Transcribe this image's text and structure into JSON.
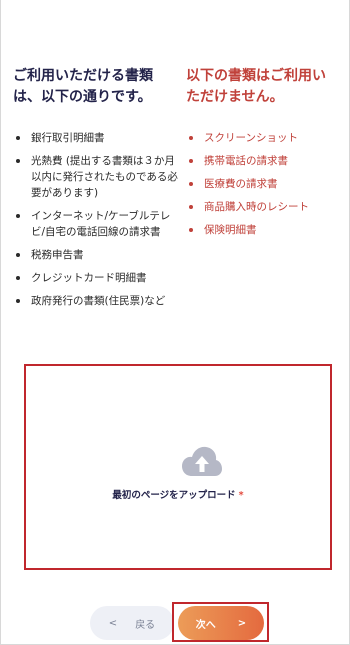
{
  "accepted": {
    "heading_line1": "ご利用いただける書類",
    "heading_line2": "は、以下の通りです。",
    "items": [
      "銀行取引明細書",
      "光熱費 (提出する書類は３か月以内に発行されたものである必要があります)",
      "インターネット/ケーブルテレビ/自宅の電話回線の請求書",
      "税務申告書",
      "クレジットカード明細書",
      "政府発行の書類(住民票)など"
    ]
  },
  "rejected": {
    "heading_line1": "以下の書類はご利用い",
    "heading_line2": "ただけません。",
    "items": [
      "スクリーンショット",
      "携帯電話の請求書",
      "医療費の請求書",
      "商品購入時のレシート",
      "保険明細書"
    ]
  },
  "upload": {
    "label": "最初のページをアップロード",
    "required_mark": "*",
    "icon": "cloud-upload-icon"
  },
  "nav": {
    "back_arrow": "<",
    "back_label": "戻る",
    "next_label": "次へ",
    "next_arrow": ">"
  },
  "colors": {
    "accepted_text": "#23234a",
    "rejected_text": "#c0413a",
    "highlight_border": "#c0272d",
    "next_gradient_start": "#ec9c58",
    "next_gradient_end": "#e46a3f",
    "icon_gray": "#b5b8c6"
  }
}
